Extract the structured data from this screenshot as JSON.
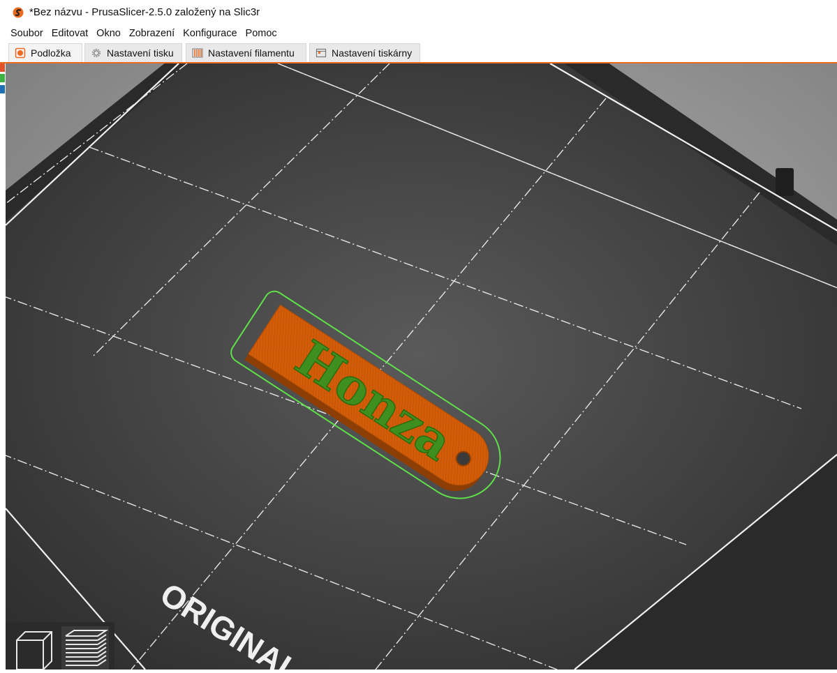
{
  "window": {
    "title": "*Bez názvu - PrusaSlicer-2.5.0 založený na Slic3r",
    "icon": "prusaslicer-logo-icon"
  },
  "menu": {
    "items": [
      "Soubor",
      "Editovat",
      "Okno",
      "Zobrazení",
      "Konfigurace",
      "Pomoc"
    ]
  },
  "tabs": [
    {
      "label": "Podložka",
      "icon": "plater-icon",
      "active": true
    },
    {
      "label": "Nastavení tisku",
      "icon": "gear-icon",
      "active": false
    },
    {
      "label": "Nastavení filamentu",
      "icon": "spool-icon",
      "active": false
    },
    {
      "label": "Nastavení tiskárny",
      "icon": "printer-icon",
      "active": false
    }
  ],
  "scene": {
    "bed_text": "ORIGINAL",
    "model_text": "Honza",
    "colors": {
      "background": "#8f8f8f",
      "bed": "#3d3d3d",
      "bed_frame": "#2a2a2a",
      "model": "#d45e0a",
      "text": "#3f8f1e",
      "outline": "#5fe04a",
      "accent": "#ed6b21"
    }
  },
  "view_toolbar": {
    "buttons": [
      {
        "name": "3d-view",
        "icon": "cube-icon"
      },
      {
        "name": "preview",
        "icon": "layers-icon"
      }
    ]
  }
}
